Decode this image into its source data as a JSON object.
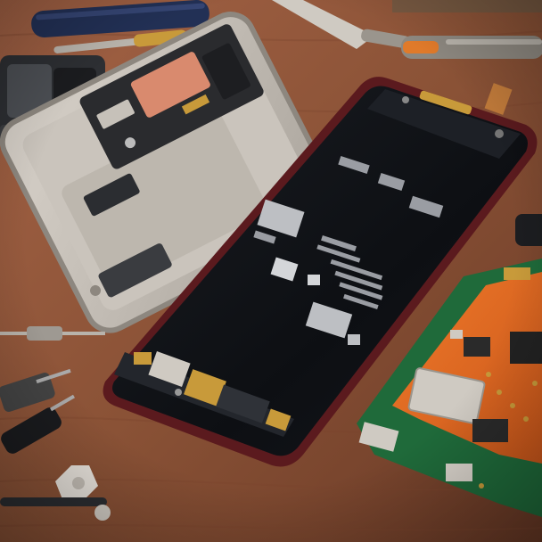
{
  "scene": {
    "kind": "photo",
    "colors": {
      "table": "#8a5236",
      "table_dark": "#5e3421",
      "table_light": "#a8684a",
      "frame_silver": "#c9c3bb",
      "frame_edge": "#8d877f",
      "screen_black": "#101216",
      "phone_bezel": "#5b1a1e",
      "pcb_orange": "#e0671e",
      "pcb_green": "#1f6a3a",
      "chip_silver": "#cfcac2",
      "gold": "#c89a3a",
      "copper_pad": "#d98a6e",
      "tool_blue": "#223055"
    }
  }
}
